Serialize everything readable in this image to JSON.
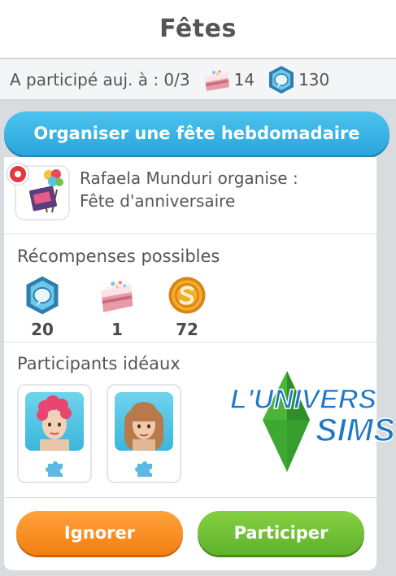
{
  "header": {
    "title": "Fêtes"
  },
  "status": {
    "participation_text": "A participé auj. à : 0/3",
    "cake_count": "14",
    "social_points": "130"
  },
  "organize_button": {
    "label": "Organiser une fête hebdomadaire"
  },
  "party": {
    "line1": "Rafaela Munduri organise :",
    "line2": "Fête d'anniversaire",
    "icon": "birthday-party-icon"
  },
  "rewards": {
    "title": "Récompenses possibles",
    "items": [
      {
        "icon": "social-points-icon",
        "value": "20"
      },
      {
        "icon": "cake-icon",
        "value": "1"
      },
      {
        "icon": "simoleon-coin-icon",
        "value": "72"
      }
    ]
  },
  "participants": {
    "title": "Participants idéaux",
    "sims": [
      {
        "hair_color": "#e8466e",
        "icon": "puzzle-icon"
      },
      {
        "hair_color": "#b87a4a",
        "icon": "puzzle-icon"
      }
    ]
  },
  "watermark": {
    "line1": "L'UNIVERS",
    "line2": "SIMS"
  },
  "actions": {
    "ignore_label": "Ignorer",
    "join_label": "Participer"
  },
  "colors": {
    "blue": "#2aa5dc",
    "orange": "#f27f12",
    "green": "#5fb22a"
  }
}
